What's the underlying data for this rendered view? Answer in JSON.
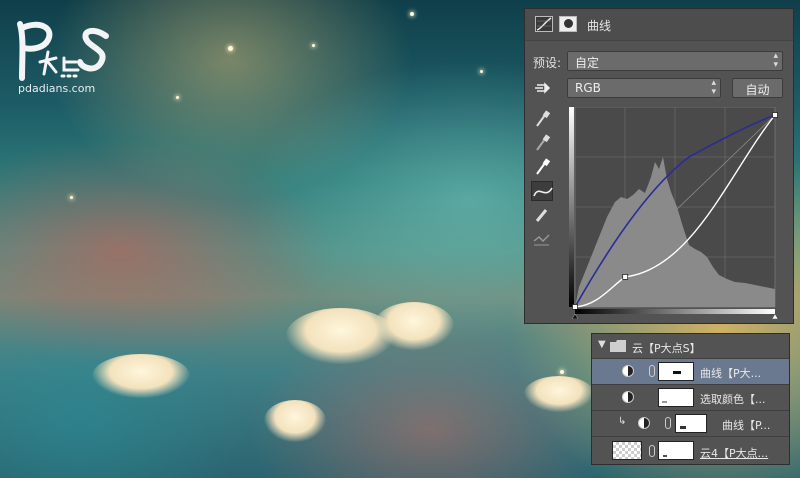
{
  "watermark": {
    "sub_text": "pdadians.com"
  },
  "properties": {
    "title": "曲线",
    "preset_label": "预设:",
    "preset_value": "自定",
    "channel_value": "RGB",
    "auto_label": "自动"
  },
  "curve": {
    "points": [
      [
        0,
        0
      ],
      [
        64,
        40
      ],
      [
        255,
        255
      ]
    ]
  },
  "layers": {
    "group_name": "云【P大点S】",
    "items": [
      {
        "name": "曲线【P大..."
      },
      {
        "name": "选取颜色【..."
      },
      {
        "name": "曲线【P..."
      },
      {
        "name": "云4【P大点..."
      }
    ]
  },
  "colors": {
    "panel_bg": "#535353",
    "selected_layer": "#6a7890",
    "curve_blue": "#2b2b9a"
  }
}
